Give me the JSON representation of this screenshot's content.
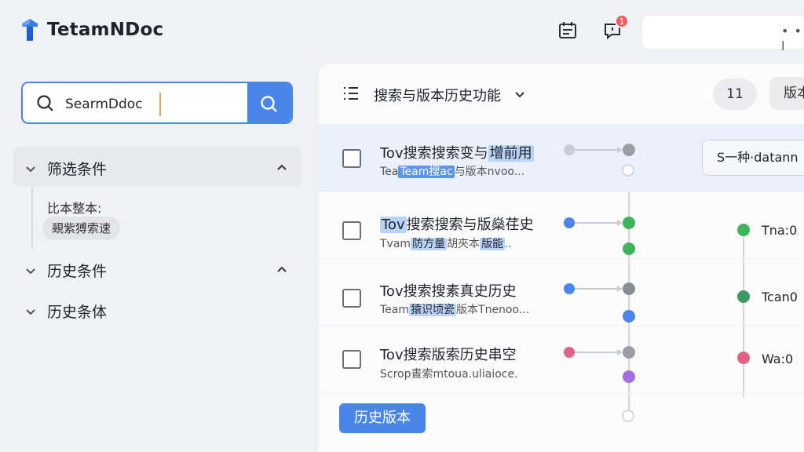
{
  "app": {
    "logo_text": "TetamNDoc"
  },
  "topbar": {
    "icons": [
      "calendar-list-icon",
      "chat-notification-icon",
      "message-icon",
      "search-icon"
    ],
    "notification_count": "1",
    "more_text": "• • l"
  },
  "sidebar": {
    "search": {
      "value": "SearmDdoc"
    },
    "sections": [
      {
        "label": "筛选条件",
        "expanded": true
      },
      {
        "label": "历史条件",
        "expanded": true
      },
      {
        "label": "历史条体",
        "expanded": false
      }
    ],
    "filter": {
      "label": "比本整本:",
      "chip": "覡紫猼索速"
    }
  },
  "main": {
    "title": "搜索与版本历史功能",
    "count": "11",
    "version_button": "版本",
    "rows": [
      {
        "title_pre": "Tov搜索搜索变与",
        "title_hl": "增前用",
        "sub_pre": "Tea",
        "sub_hl": "Team搜ac",
        "sub_post": "与版本nvoo...",
        "selected": true,
        "dot_color": "#c8ccd3",
        "node_color": "#9b9ea5"
      },
      {
        "title_hl": "Tov",
        "title_post": "搜索搜索与版燊荏史",
        "sub_pre": "Tvam",
        "sub_hl": "防方量",
        "sub_mid": "胡夾本",
        "sub_hl2": "版能",
        "sub_post": "..",
        "selected": false,
        "dot_color": "#4a86e8",
        "node_color": "#3cb45a"
      },
      {
        "title_pre": "Tov搜索搜素真史历史",
        "sub_pre": "Team",
        "sub_hl": "猿识顷瓷",
        "sub_post": "版本Tnenoo...",
        "selected": false,
        "dot_color": "#4a86e8",
        "node_color": "#8a8d93"
      },
      {
        "title_pre": "Tov搜索版索历史串空",
        "sub_pre": "Scrop晝索mtoua.uliaioce.",
        "selected": false,
        "dot_color": "#e06383",
        "node_color": "#9b9ea5"
      }
    ],
    "right": {
      "card_text": "S一种·datann",
      "labels": [
        "Tna:0",
        "Tcan0",
        "Wa:0"
      ],
      "label_colors": [
        "#3cb45a",
        "#3c9a5f",
        "#e06383"
      ]
    },
    "history_button": "历史版本"
  }
}
